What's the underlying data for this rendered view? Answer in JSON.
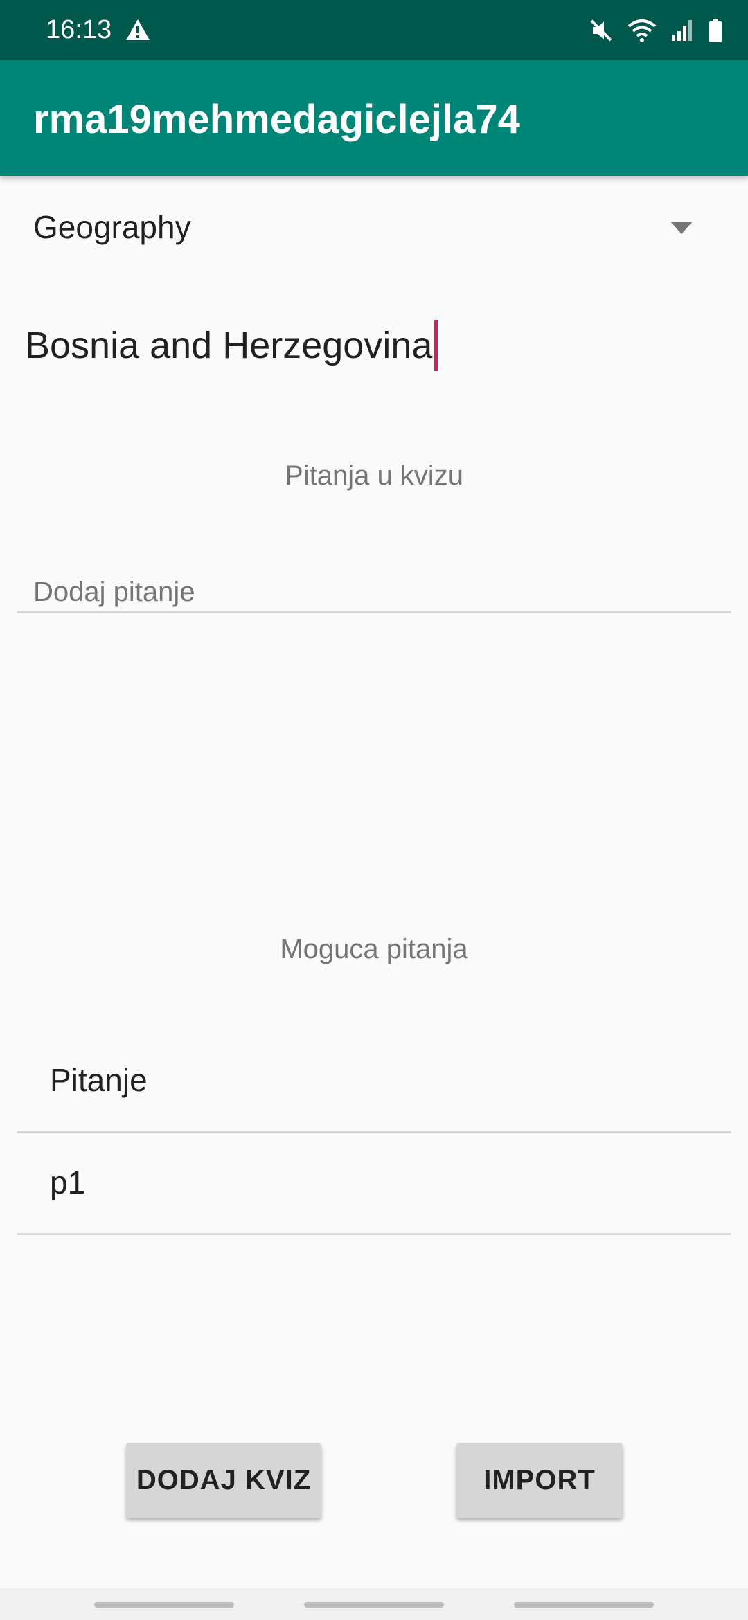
{
  "status_bar": {
    "time": "16:13",
    "icons": [
      "warning-icon",
      "mute-icon",
      "wifi-icon",
      "signal-icon",
      "battery-icon"
    ]
  },
  "app_bar": {
    "title": "rma19mehmedagiclejla74"
  },
  "category_spinner": {
    "selected": "Geography"
  },
  "quiz_name_input": {
    "value": "Bosnia and Herzegovina"
  },
  "quiz_questions": {
    "label": "Pitanja u kvizu",
    "add_item": "Dodaj pitanje"
  },
  "possible_questions": {
    "label": "Moguca pitanja",
    "items": [
      "Pitanje",
      "p1"
    ]
  },
  "buttons": {
    "add_quiz": "DODAJ KVIZ",
    "import": "IMPORT"
  },
  "colors": {
    "status_bar": "#00574b",
    "app_bar": "#008577",
    "accent": "#d81b60"
  }
}
